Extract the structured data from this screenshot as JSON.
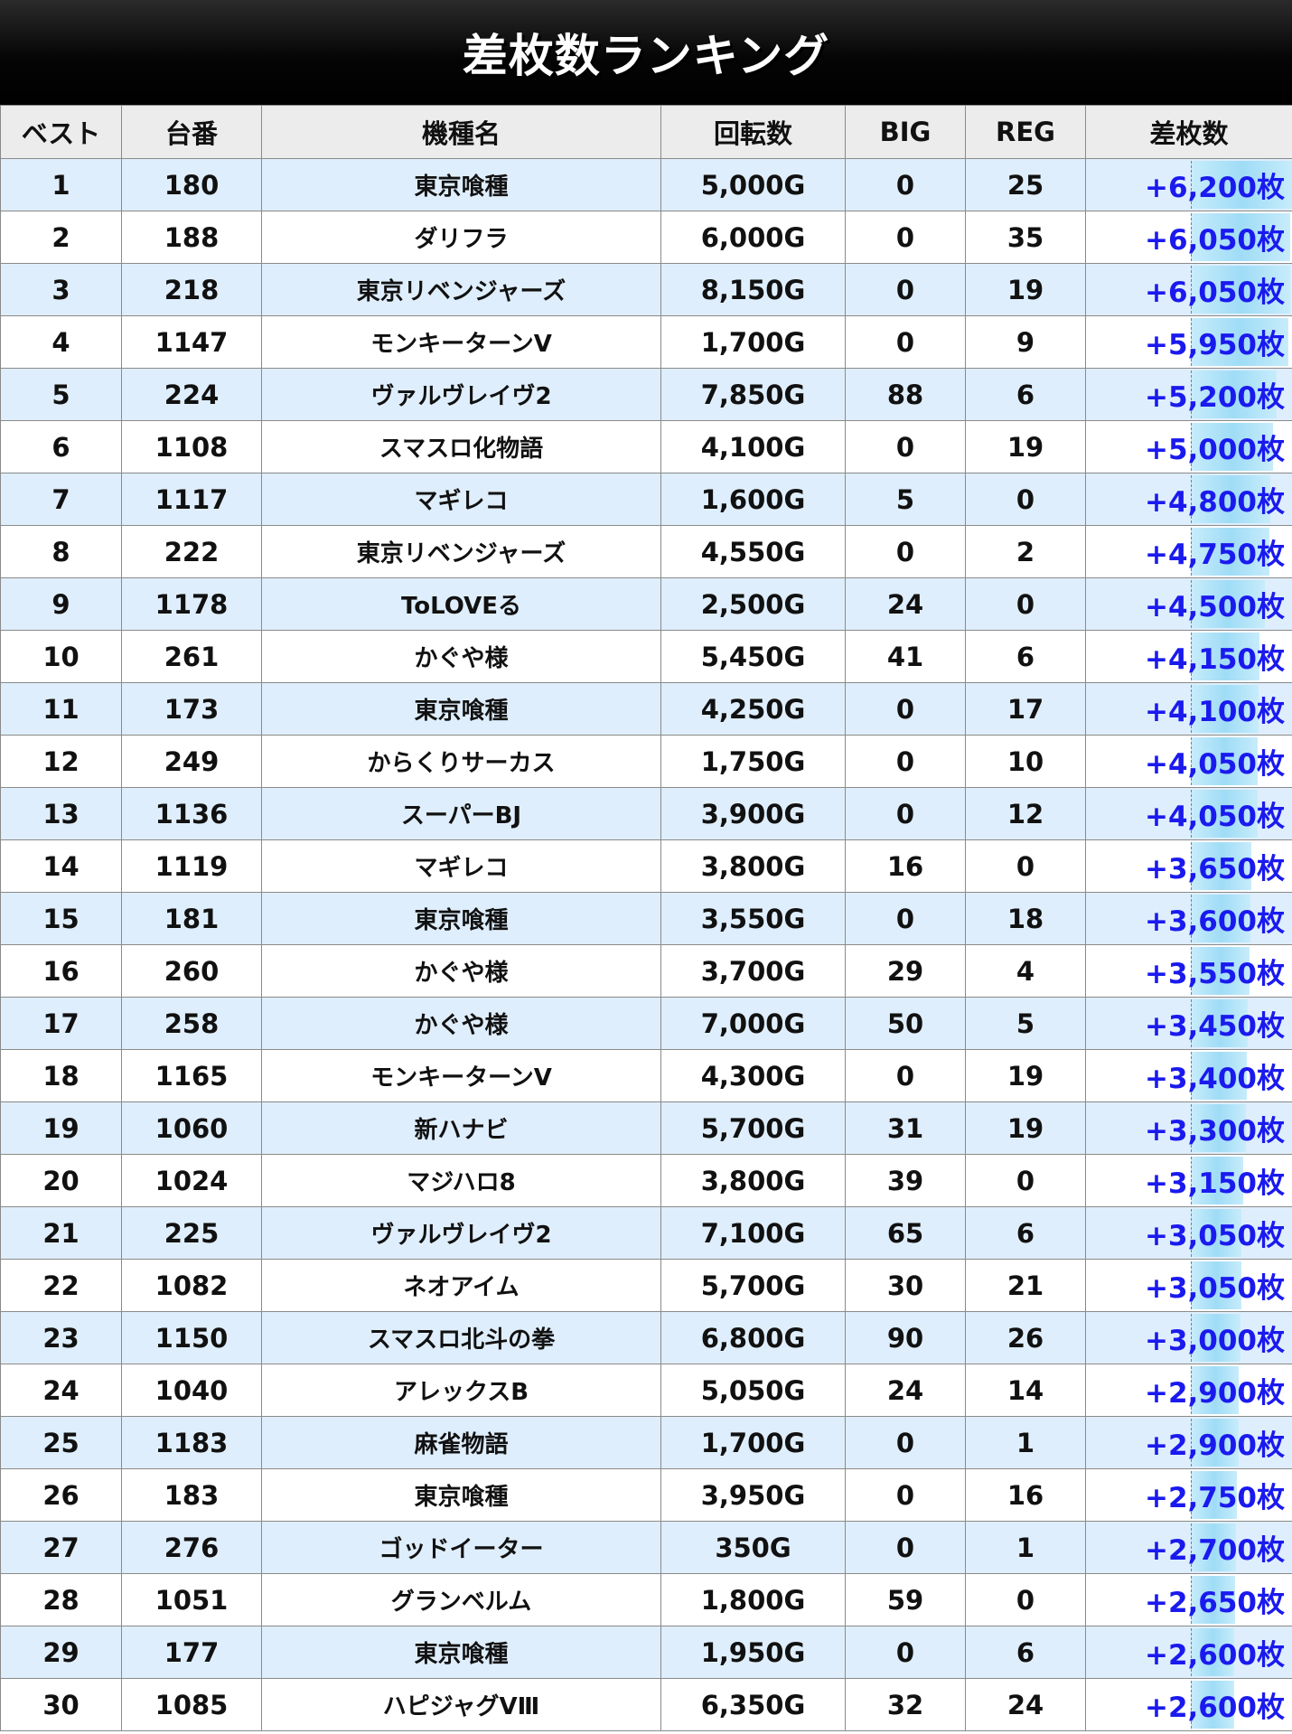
{
  "title": "差枚数ランキング",
  "columns": [
    "ベスト",
    "台番",
    "機種名",
    "回転数",
    "BIG",
    "REG",
    "差枚数"
  ],
  "accent_colors": {
    "diff_text": "#1a1aee",
    "row_alt": "#dfeefc",
    "bar": "#9fdcf6",
    "header_bg": "#000000"
  },
  "rows": [
    {
      "rank": "1",
      "machine_no": "180",
      "name": "東京喰種",
      "spins": "5,000G",
      "big": "0",
      "reg": "25",
      "diff": "+6,200枚",
      "diff_value": 6200
    },
    {
      "rank": "2",
      "machine_no": "188",
      "name": "ダリフラ",
      "spins": "6,000G",
      "big": "0",
      "reg": "35",
      "diff": "+6,050枚",
      "diff_value": 6050
    },
    {
      "rank": "3",
      "machine_no": "218",
      "name": "東京リベンジャーズ",
      "spins": "8,150G",
      "big": "0",
      "reg": "19",
      "diff": "+6,050枚",
      "diff_value": 6050
    },
    {
      "rank": "4",
      "machine_no": "1147",
      "name": "モンキーターンV",
      "spins": "1,700G",
      "big": "0",
      "reg": "9",
      "diff": "+5,950枚",
      "diff_value": 5950
    },
    {
      "rank": "5",
      "machine_no": "224",
      "name": "ヴァルヴレイヴ2",
      "spins": "7,850G",
      "big": "88",
      "reg": "6",
      "diff": "+5,200枚",
      "diff_value": 5200
    },
    {
      "rank": "6",
      "machine_no": "1108",
      "name": "スマスロ化物語",
      "spins": "4,100G",
      "big": "0",
      "reg": "19",
      "diff": "+5,000枚",
      "diff_value": 5000
    },
    {
      "rank": "7",
      "machine_no": "1117",
      "name": "マギレコ",
      "spins": "1,600G",
      "big": "5",
      "reg": "0",
      "diff": "+4,800枚",
      "diff_value": 4800
    },
    {
      "rank": "8",
      "machine_no": "222",
      "name": "東京リベンジャーズ",
      "spins": "4,550G",
      "big": "0",
      "reg": "2",
      "diff": "+4,750枚",
      "diff_value": 4750
    },
    {
      "rank": "9",
      "machine_no": "1178",
      "name": "ToLOVEる",
      "spins": "2,500G",
      "big": "24",
      "reg": "0",
      "diff": "+4,500枚",
      "diff_value": 4500
    },
    {
      "rank": "10",
      "machine_no": "261",
      "name": "かぐや様",
      "spins": "5,450G",
      "big": "41",
      "reg": "6",
      "diff": "+4,150枚",
      "diff_value": 4150
    },
    {
      "rank": "11",
      "machine_no": "173",
      "name": "東京喰種",
      "spins": "4,250G",
      "big": "0",
      "reg": "17",
      "diff": "+4,100枚",
      "diff_value": 4100
    },
    {
      "rank": "12",
      "machine_no": "249",
      "name": "からくりサーカス",
      "spins": "1,750G",
      "big": "0",
      "reg": "10",
      "diff": "+4,050枚",
      "diff_value": 4050
    },
    {
      "rank": "13",
      "machine_no": "1136",
      "name": "スーパーBJ",
      "spins": "3,900G",
      "big": "0",
      "reg": "12",
      "diff": "+4,050枚",
      "diff_value": 4050
    },
    {
      "rank": "14",
      "machine_no": "1119",
      "name": "マギレコ",
      "spins": "3,800G",
      "big": "16",
      "reg": "0",
      "diff": "+3,650枚",
      "diff_value": 3650
    },
    {
      "rank": "15",
      "machine_no": "181",
      "name": "東京喰種",
      "spins": "3,550G",
      "big": "0",
      "reg": "18",
      "diff": "+3,600枚",
      "diff_value": 3600
    },
    {
      "rank": "16",
      "machine_no": "260",
      "name": "かぐや様",
      "spins": "3,700G",
      "big": "29",
      "reg": "4",
      "diff": "+3,550枚",
      "diff_value": 3550
    },
    {
      "rank": "17",
      "machine_no": "258",
      "name": "かぐや様",
      "spins": "7,000G",
      "big": "50",
      "reg": "5",
      "diff": "+3,450枚",
      "diff_value": 3450
    },
    {
      "rank": "18",
      "machine_no": "1165",
      "name": "モンキーターンV",
      "spins": "4,300G",
      "big": "0",
      "reg": "19",
      "diff": "+3,400枚",
      "diff_value": 3400
    },
    {
      "rank": "19",
      "machine_no": "1060",
      "name": "新ハナビ",
      "spins": "5,700G",
      "big": "31",
      "reg": "19",
      "diff": "+3,300枚",
      "diff_value": 3300
    },
    {
      "rank": "20",
      "machine_no": "1024",
      "name": "マジハロ8",
      "spins": "3,800G",
      "big": "39",
      "reg": "0",
      "diff": "+3,150枚",
      "diff_value": 3150
    },
    {
      "rank": "21",
      "machine_no": "225",
      "name": "ヴァルヴレイヴ2",
      "spins": "7,100G",
      "big": "65",
      "reg": "6",
      "diff": "+3,050枚",
      "diff_value": 3050
    },
    {
      "rank": "22",
      "machine_no": "1082",
      "name": "ネオアイム",
      "spins": "5,700G",
      "big": "30",
      "reg": "21",
      "diff": "+3,050枚",
      "diff_value": 3050
    },
    {
      "rank": "23",
      "machine_no": "1150",
      "name": "スマスロ北斗の拳",
      "spins": "6,800G",
      "big": "90",
      "reg": "26",
      "diff": "+3,000枚",
      "diff_value": 3000
    },
    {
      "rank": "24",
      "machine_no": "1040",
      "name": "アレックスB",
      "spins": "5,050G",
      "big": "24",
      "reg": "14",
      "diff": "+2,900枚",
      "diff_value": 2900
    },
    {
      "rank": "25",
      "machine_no": "1183",
      "name": "麻雀物語",
      "spins": "1,700G",
      "big": "0",
      "reg": "1",
      "diff": "+2,900枚",
      "diff_value": 2900
    },
    {
      "rank": "26",
      "machine_no": "183",
      "name": "東京喰種",
      "spins": "3,950G",
      "big": "0",
      "reg": "16",
      "diff": "+2,750枚",
      "diff_value": 2750
    },
    {
      "rank": "27",
      "machine_no": "276",
      "name": "ゴッドイーター",
      "spins": "350G",
      "big": "0",
      "reg": "1",
      "diff": "+2,700枚",
      "diff_value": 2700
    },
    {
      "rank": "28",
      "machine_no": "1051",
      "name": "グランベルム",
      "spins": "1,800G",
      "big": "59",
      "reg": "0",
      "diff": "+2,650枚",
      "diff_value": 2650
    },
    {
      "rank": "29",
      "machine_no": "177",
      "name": "東京喰種",
      "spins": "1,950G",
      "big": "0",
      "reg": "6",
      "diff": "+2,600枚",
      "diff_value": 2600
    },
    {
      "rank": "30",
      "machine_no": "1085",
      "name": "ハピジャグVⅢ",
      "spins": "6,350G",
      "big": "32",
      "reg": "24",
      "diff": "+2,600枚",
      "diff_value": 2600
    }
  ]
}
